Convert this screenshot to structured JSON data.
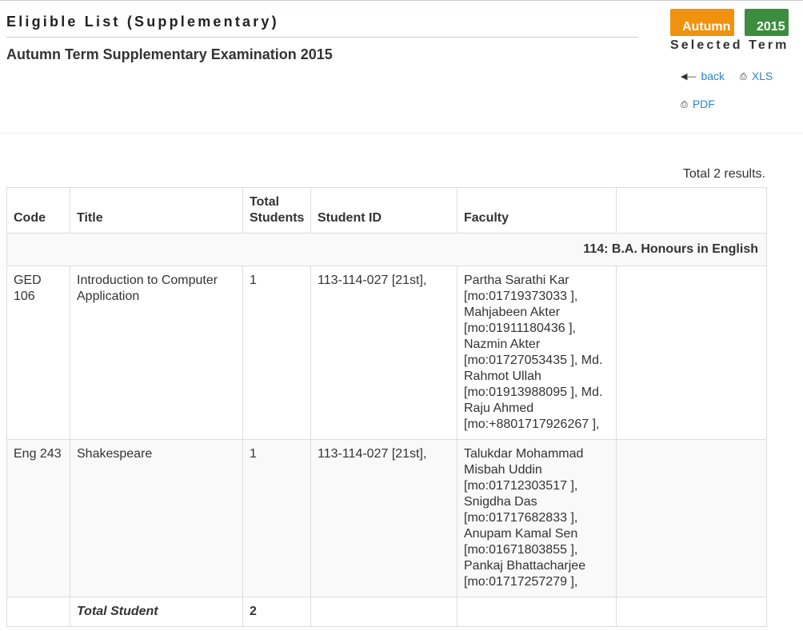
{
  "header": {
    "page_title": "Eligible List (Supplementary)",
    "subtitle": "Autumn Term Supplementary Examination 2015"
  },
  "term": {
    "name": "Autumn",
    "year": "2015",
    "label": "Selected Term",
    "colors": {
      "term": "#f0910f",
      "year": "#3c8d3f"
    }
  },
  "actions": {
    "back": "back",
    "xls": "XLS",
    "pdf": "PDF",
    "icons": {
      "back": "arrow-left-icon",
      "xls": "print-icon",
      "pdf": "print-icon"
    }
  },
  "results": {
    "total_text": "Total 2 results.",
    "columns": [
      "Code",
      "Title",
      "Total Students",
      "Student ID",
      "Faculty",
      ""
    ],
    "group_label": "114: B.A. Honours in English",
    "rows": [
      {
        "code": "GED 106",
        "title": "Introduction to Computer Application",
        "total": "1",
        "student_id": "113-114-027 [21st],",
        "faculty": "Partha Sarathi Kar [mo:01719373033 ], Mahjabeen Akter [mo:01911180436 ], Nazmin Akter [mo:01727053435 ], Md. Rahmot Ullah [mo:01913988095 ], Md. Raju Ahmed [mo:+8801717926267 ],"
      },
      {
        "code": "Eng 243",
        "title": "Shakespeare",
        "total": "1",
        "student_id": "113-114-027 [21st],",
        "faculty": "Talukdar Mohammad Misbah Uddin [mo:01712303517 ], Snigdha Das [mo:01717682833 ], Anupam Kamal Sen [mo:01671803855 ], Pankaj Bhattacharjee [mo:01717257279 ],"
      }
    ],
    "footer": {
      "label": "Total Student",
      "value": "2"
    }
  },
  "colors": {
    "link": "#2a86c6",
    "stripe": "#f9f9f9",
    "border": "#dddddd"
  }
}
